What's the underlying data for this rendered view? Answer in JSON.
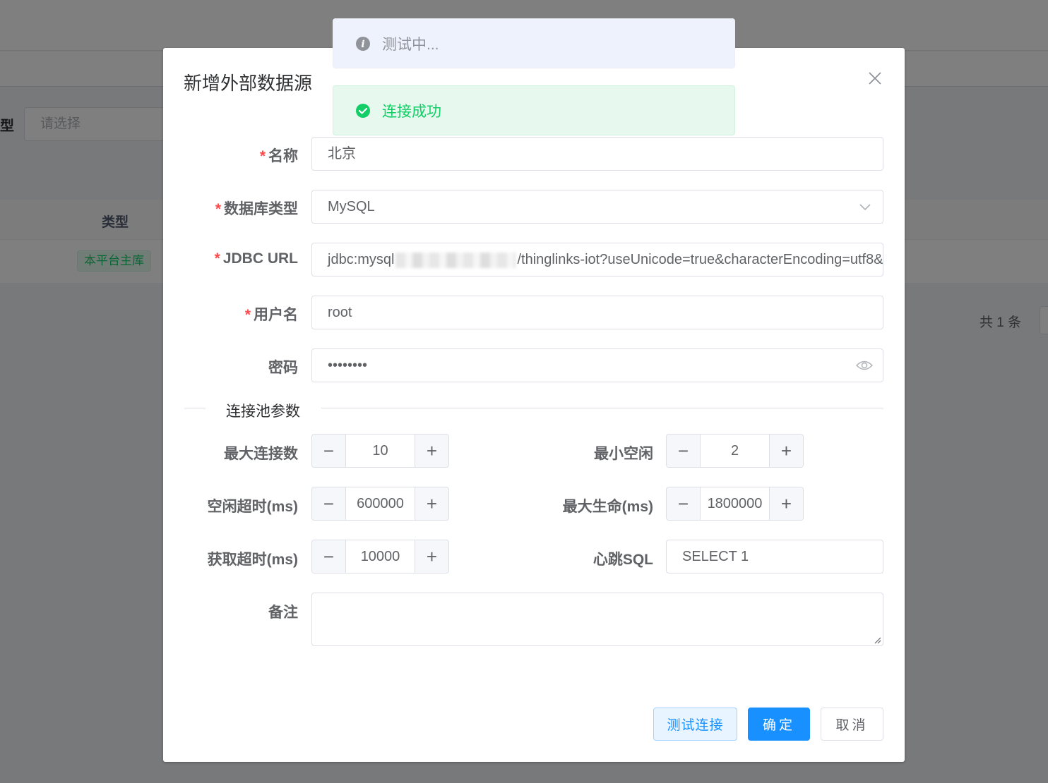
{
  "background": {
    "filter_label": "型",
    "filter_placeholder": "请选择",
    "table_header_type": "类型",
    "row_tag": "本平台主库",
    "pagination_total": "共 1 条"
  },
  "messages": {
    "info": "测试中...",
    "success": "连接成功"
  },
  "dialog": {
    "title": "新增外部数据源",
    "fields": {
      "name": {
        "label": "名称",
        "value": "北京"
      },
      "db_type": {
        "label": "数据库类型",
        "value": "MySQL"
      },
      "jdbc_url": {
        "label": "JDBC URL",
        "value_prefix": "jdbc:mysql",
        "value_suffix": "/thinglinks-iot?useUnicode=true&characterEncoding=utf8&"
      },
      "username": {
        "label": "用户名",
        "value": "root"
      },
      "password": {
        "label": "密码",
        "value": "••••••••"
      }
    },
    "pool_section_title": "连接池参数",
    "pool": {
      "max_connections": {
        "label": "最大连接数",
        "value": "10"
      },
      "min_idle": {
        "label": "最小空闲",
        "value": "2"
      },
      "idle_timeout": {
        "label": "空闲超时(ms)",
        "value": "600000"
      },
      "max_lifetime": {
        "label": "最大生命(ms)",
        "value": "1800000"
      },
      "acquire_timeout": {
        "label": "获取超时(ms)",
        "value": "10000"
      },
      "heartbeat_sql": {
        "label": "心跳SQL",
        "value": "SELECT 1"
      }
    },
    "remark": {
      "label": "备注",
      "value": ""
    },
    "buttons": {
      "test": "测试连接",
      "confirm": "确定",
      "cancel": "取消"
    }
  },
  "colors": {
    "primary": "#1890ff",
    "success": "#13ce66",
    "required": "#ff4949"
  },
  "icons": [
    "info-icon",
    "success-check-icon",
    "close-icon",
    "chevron-down-icon",
    "eye-icon",
    "minus-icon",
    "plus-icon",
    "resize-handle-icon"
  ]
}
